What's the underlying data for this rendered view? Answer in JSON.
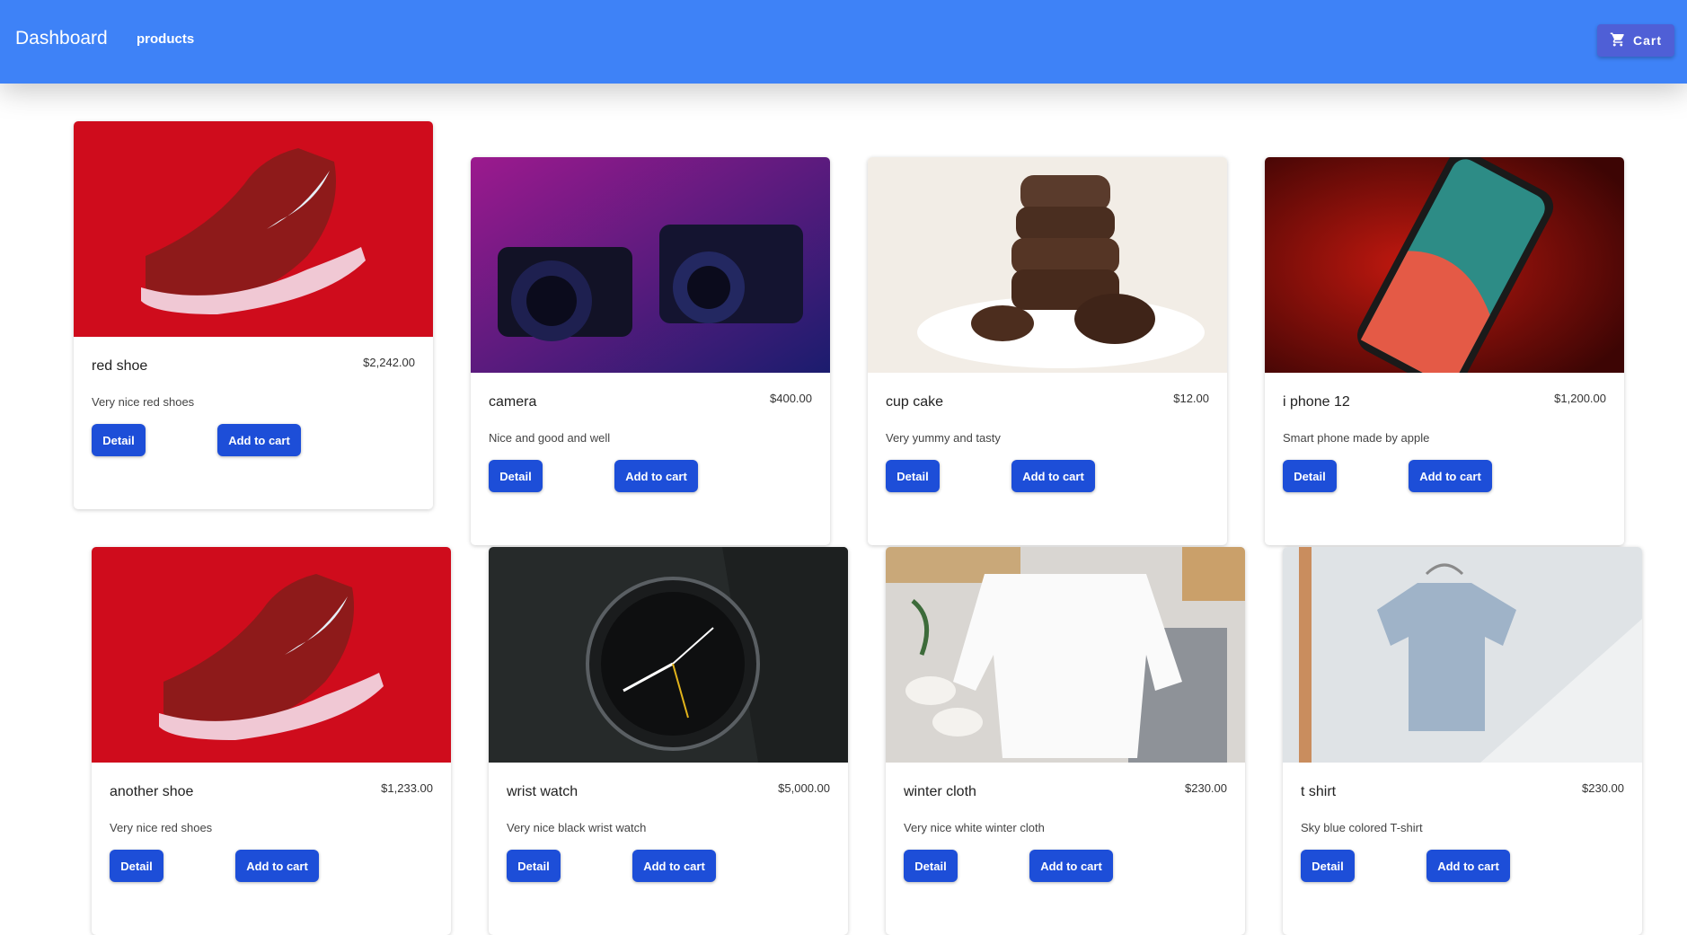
{
  "header": {
    "brand": "Dashboard",
    "nav_products": "products",
    "cart_label": "Cart",
    "cart_icon": "shopping-cart-icon",
    "bg_color": "#3e82f7"
  },
  "buttons": {
    "detail": "Detail",
    "add_to_cart": "Add to cart",
    "color": "#1d4ed8"
  },
  "products": [
    {
      "name": "red shoe",
      "price": "$2,242.00",
      "description": "Very nice red shoes",
      "image": "red-shoe-image"
    },
    {
      "name": "camera",
      "price": "$400.00",
      "description": "Nice and good and well",
      "image": "camera-image"
    },
    {
      "name": "cup cake",
      "price": "$12.00",
      "description": "Very yummy and tasty",
      "image": "cup-cake-image"
    },
    {
      "name": "i phone 12",
      "price": "$1,200.00",
      "description": "Smart phone made by apple",
      "image": "iphone-image"
    },
    {
      "name": "another shoe",
      "price": "$1,233.00",
      "description": "Very nice red shoes",
      "image": "red-shoe-image"
    },
    {
      "name": "wrist watch",
      "price": "$5,000.00",
      "description": "Very nice black wrist watch",
      "image": "wrist-watch-image"
    },
    {
      "name": "winter cloth",
      "price": "$230.00",
      "description": "Very nice white winter cloth",
      "image": "winter-cloth-image"
    },
    {
      "name": "t shirt",
      "price": "$230.00",
      "description": "Sky blue colored T-shirt",
      "image": "t-shirt-image"
    }
  ]
}
